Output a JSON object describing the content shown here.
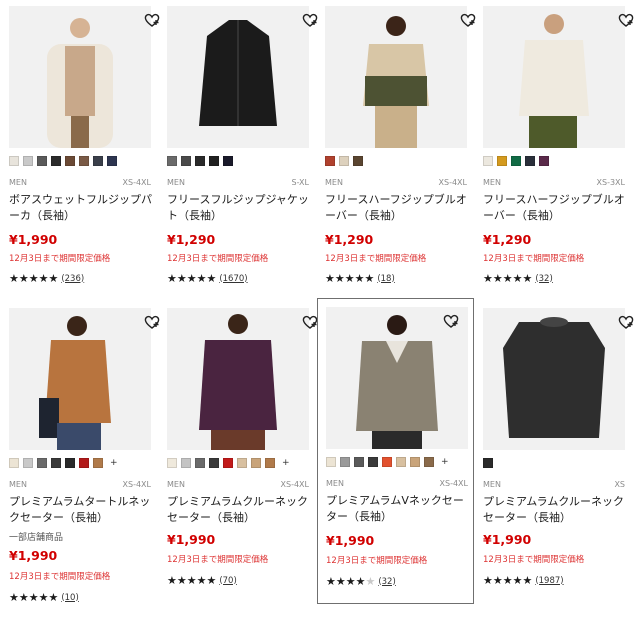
{
  "products": [
    {
      "category": "MEN",
      "size": "XS-4XL",
      "name": "ボアスウェットフルジップパーカ（長袖）",
      "note": "",
      "price": "¥1,990",
      "limited": "12月3日まで期間限定価格",
      "stars": "★★★★",
      "star_half": "★",
      "star_off": "",
      "count": "(236)",
      "rating_value": 4.5,
      "swatches": [
        "#e8e4dc",
        "#c9c9c9",
        "#5a5a5a",
        "#2b2b2b",
        "#6b4a35",
        "#7a5a46",
        "#3a3f4a",
        "#2d3550"
      ],
      "more": ""
    },
    {
      "category": "MEN",
      "size": "S-XL",
      "name": "フリースフルジップジャケット（長袖）",
      "note": "",
      "price": "¥1,290",
      "limited": "12月3日まで期間限定価格",
      "stars": "★★★★",
      "star_half": "★",
      "star_off": "",
      "count": "(1670)",
      "rating_value": 4.5,
      "swatches": [
        "#6a6a6a",
        "#4a4a4a",
        "#2a2a2a",
        "#202020",
        "#1a1a2a"
      ],
      "more": ""
    },
    {
      "category": "MEN",
      "size": "XS-4XL",
      "name": "フリースハーフジップブルオーバー（長袖）",
      "note": "",
      "price": "¥1,290",
      "limited": "12月3日まで期間限定価格",
      "stars": "★★★★",
      "star_half": "★",
      "star_off": "",
      "count": "(18)",
      "rating_value": 4.5,
      "swatches": [
        "#b0412e",
        "#ddd1bd",
        "#5a4530"
      ],
      "more": ""
    },
    {
      "category": "MEN",
      "size": "XS-3XL",
      "name": "フリースハーフジップブルオーバー（長袖）",
      "note": "",
      "price": "¥1,290",
      "limited": "12月3日まで期間限定価格",
      "stars": "★★★★",
      "star_half": "★",
      "star_off": "",
      "count": "(32)",
      "rating_value": 4.5,
      "swatches": [
        "#ece8df",
        "#d49a1e",
        "#116b45",
        "#2a2f3a",
        "#5a2a4a"
      ],
      "more": ""
    },
    {
      "category": "MEN",
      "size": "XS-4XL",
      "name": "プレミアムラムタートルネックセーター（長袖）",
      "note": "一部店舗商品",
      "price": "¥1,990",
      "limited": "12月3日まで期間限定価格",
      "stars": "★★★★",
      "star_half": "★",
      "star_off": "",
      "count": "(10)",
      "rating_value": 4.5,
      "swatches": [
        "#ece4d4",
        "#c9c9c9",
        "#6a6a6a",
        "#3a3a3a",
        "#2a2a2a",
        "#b11a1a",
        "#b07a4a"
      ],
      "more": "+"
    },
    {
      "category": "MEN",
      "size": "XS-4XL",
      "name": "プレミアムラムクルーネックセーター（長袖）",
      "note": "",
      "price": "¥1,990",
      "limited": "12月3日まで期間限定価格",
      "stars": "★★★★",
      "star_half": "★",
      "star_off": "",
      "count": "(70)",
      "rating_value": 4.5,
      "swatches": [
        "#efe9dc",
        "#c4c4c4",
        "#6a6a6a",
        "#3a3a3a",
        "#c21a1a",
        "#d8c0a0",
        "#c9a47a",
        "#b07a4a"
      ],
      "more": "+"
    },
    {
      "category": "MEN",
      "size": "XS-4XL",
      "name": "プレミアムラムVネックセーター（長袖）",
      "note": "",
      "price": "¥1,990",
      "limited": "12月3日まで期間限定価格",
      "stars": "★★★★",
      "star_half": "",
      "star_off": "★",
      "count": "(32)",
      "rating_value": 4,
      "swatches": [
        "#ece4d4",
        "#9a9a9a",
        "#5a5a5a",
        "#3a3a3a",
        "#e2512e",
        "#d8c0a0",
        "#c9a47a",
        "#8a6a4a"
      ],
      "more": "+"
    },
    {
      "category": "MEN",
      "size": "XS",
      "name": "プレミアムラムクルーネックセーター（長袖）",
      "note": "",
      "price": "¥1,990",
      "limited": "12月3日まで期間限定価格",
      "stars": "★★★★",
      "star_half": "★",
      "star_off": "",
      "count": "(1987)",
      "rating_value": 4.5,
      "swatches": [
        "#2a2a2a"
      ],
      "more": ""
    }
  ]
}
